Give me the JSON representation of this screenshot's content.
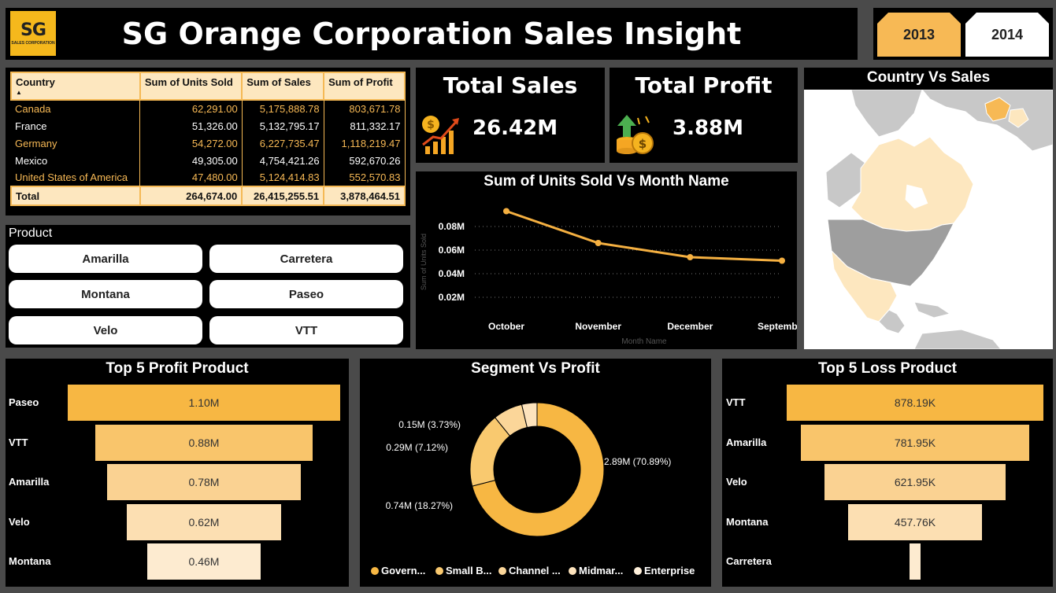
{
  "header": {
    "logo_text": "SG",
    "logo_subtext": "SALES CORPORATION",
    "title": "SG Orange Corporation Sales Insight"
  },
  "year_slicer": [
    "2013",
    "2014"
  ],
  "country_table": {
    "columns": [
      "Country",
      "Sum of Units Sold",
      "Sum of Sales",
      "Sum of Profit"
    ],
    "rows": [
      [
        "Canada",
        "62,291.00",
        "5,175,888.78",
        "803,671.78"
      ],
      [
        "France",
        "51,326.00",
        "5,132,795.17",
        "811,332.17"
      ],
      [
        "Germany",
        "54,272.00",
        "6,227,735.47",
        "1,118,219.47"
      ],
      [
        "Mexico",
        "49,305.00",
        "4,754,421.26",
        "592,670.26"
      ],
      [
        "United States of America",
        "47,480.00",
        "5,124,414.83",
        "552,570.83"
      ]
    ],
    "total": [
      "Total",
      "264,674.00",
      "26,415,255.51",
      "3,878,464.51"
    ]
  },
  "product_slicer": {
    "title": "Product",
    "items": [
      "Amarilla",
      "Carretera",
      "Montana",
      "Paseo",
      "Velo",
      "VTT"
    ]
  },
  "kpis": {
    "total_sales": {
      "title": "Total Sales",
      "value": "26.42M"
    },
    "total_profit": {
      "title": "Total Profit",
      "value": "3.88M"
    }
  },
  "map": {
    "title": "Country Vs Sales"
  },
  "chart_data": [
    {
      "type": "line",
      "title": "Sum of Units Sold Vs Month Name",
      "xlabel": "Month Name",
      "ylabel": "Sum of Units Sold",
      "categories": [
        "October",
        "November",
        "December",
        "September"
      ],
      "values": [
        0.093,
        0.066,
        0.054,
        0.051
      ],
      "y_ticks": [
        "0.08M",
        "0.06M",
        "0.04M",
        "0.02M"
      ],
      "y_tick_values": [
        0.08,
        0.06,
        0.04,
        0.02
      ],
      "ylim": [
        0,
        0.1
      ],
      "grid": true,
      "color": "#f5b041"
    },
    {
      "type": "bar",
      "title": "Top 5 Profit Product",
      "categories": [
        "Paseo",
        "VTT",
        "Amarilla",
        "Velo",
        "Montana"
      ],
      "values": [
        1.1,
        0.88,
        0.78,
        0.62,
        0.46
      ],
      "labels": [
        "1.10M",
        "0.88M",
        "0.78M",
        "0.62M",
        "0.46M"
      ],
      "colors": [
        "#f7b743",
        "#f9c56b",
        "#fad292",
        "#fcdfb2",
        "#fdebd0"
      ]
    },
    {
      "type": "pie",
      "title": "Segment Vs Profit",
      "categories": [
        "Government",
        "Small Business",
        "Channel Partners",
        "Midmarket",
        "Enterprise"
      ],
      "legend_labels": [
        "Govern...",
        "Small B...",
        "Channel ...",
        "Midmar...",
        "Enterprise"
      ],
      "values": [
        2.89,
        0.74,
        0.29,
        0.15,
        0
      ],
      "labels": [
        "2.89M (70.89%)",
        "0.74M (18.27%)",
        "0.29M (7.12%)",
        "0.15M (3.73%)",
        ""
      ],
      "colors": [
        "#f7b743",
        "#f9c96f",
        "#fbd699",
        "#fde3bc",
        "#fff0db"
      ]
    },
    {
      "type": "bar",
      "title": "Top 5 Loss Product",
      "categories": [
        "VTT",
        "Amarilla",
        "Velo",
        "Montana",
        "Carretera"
      ],
      "values": [
        878.19,
        781.95,
        621.95,
        457.76,
        0
      ],
      "labels": [
        "878.19K",
        "781.95K",
        "621.95K",
        "457.76K",
        ""
      ],
      "colors": [
        "#f7b743",
        "#f9c56b",
        "#fad292",
        "#fcdfb2",
        "#fdebd0"
      ]
    }
  ]
}
